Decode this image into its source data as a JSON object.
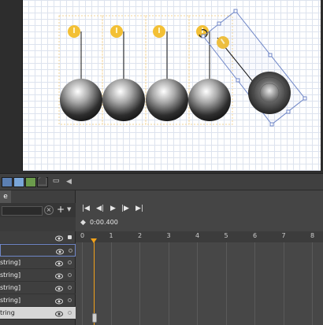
{
  "canvas": {
    "ball_count": 5,
    "colors": {
      "artboard": "#ffffff",
      "grid": "#dde3ee",
      "selection": "#6f86c7",
      "guide": "#f3c977",
      "pin": "#f3c035",
      "ball_dark": "#1c1c1c",
      "ball_light": "#ffffff"
    },
    "icons": [
      "pin-icon",
      "rotate-cursor-icon"
    ]
  },
  "toolbar": {
    "icons": [
      "grid-toggle-icon",
      "snap-toggle-icon",
      "artboard-icon",
      "zoom-fit-icon",
      "comment-icon",
      "collapse-arrow-icon"
    ]
  },
  "layers_panel": {
    "tab_label": "e",
    "add_label": "+",
    "close_label": "×",
    "rows": [
      {
        "label": "",
        "selected": false
      },
      {
        "label": "",
        "selected": true
      },
      {
        "label": "string]",
        "selected": false
      },
      {
        "label": "string]",
        "selected": false
      },
      {
        "label": "string]",
        "selected": false
      },
      {
        "label": "string]",
        "selected": false
      },
      {
        "label": "tring",
        "selected": false,
        "active": true
      }
    ]
  },
  "timeline": {
    "current_time": "0:00.400",
    "ruler_labels": [
      "0",
      "1",
      "2",
      "3",
      "4",
      "5",
      "6",
      "7",
      "8"
    ],
    "playhead_seconds": 0.4,
    "keyframe_row": 6
  }
}
